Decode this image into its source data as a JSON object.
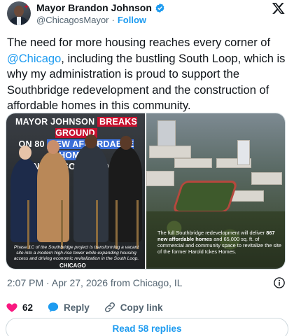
{
  "author": {
    "name": "Mayor Brandon Johnson",
    "handle": "@ChicagosMayor",
    "separator": "·",
    "follow_label": "Follow"
  },
  "tweet": {
    "text_before_mention": "The need for more housing reaches every corner of ",
    "mention": "@Chicago",
    "text_after_mention": ", including the bustling South Loop, which is why my administration is proud to support the Southbridge redevelopment and the construction of affordable homes in this community."
  },
  "media": {
    "left": {
      "headline_part1": "MAYOR JOHNSON ",
      "headline_red": "BREAKS GROUND",
      "headline_part2": "ON 80 ",
      "headline_blue": "NEW AFFORDABLE HOMES",
      "headline_line3": "IN THE SOUTH LOOP",
      "caption": "Phase 1C of the Southbridge project is transforming a vacant site into a modern high-rise tower while expanding housing access and driving economic revitalization in the South Loop.",
      "logo_text": "CHICAGO"
    },
    "right": {
      "caption_part1": "The full Southbridge redevelopment will deliver ",
      "caption_bold": "867 new affordable homes",
      "caption_part2": " and 65,000 sq. ft. of commercial and community space to revitalize the site of the former Harold Ickes Homes."
    }
  },
  "meta": {
    "timestamp": "2:07 PM · Apr 27, 2026 from Chicago, IL"
  },
  "actions": {
    "like_count": "62",
    "reply_label": "Reply",
    "copy_link_label": "Copy link"
  },
  "replies": {
    "label": "Read 58 replies"
  },
  "colors": {
    "accent": "#1d9bf0",
    "like": "#f91880",
    "text": "#0f1419",
    "muted": "#536471"
  },
  "icons": [
    "verified-badge-icon",
    "x-logo-icon",
    "info-icon",
    "heart-icon",
    "reply-icon",
    "link-icon"
  ]
}
